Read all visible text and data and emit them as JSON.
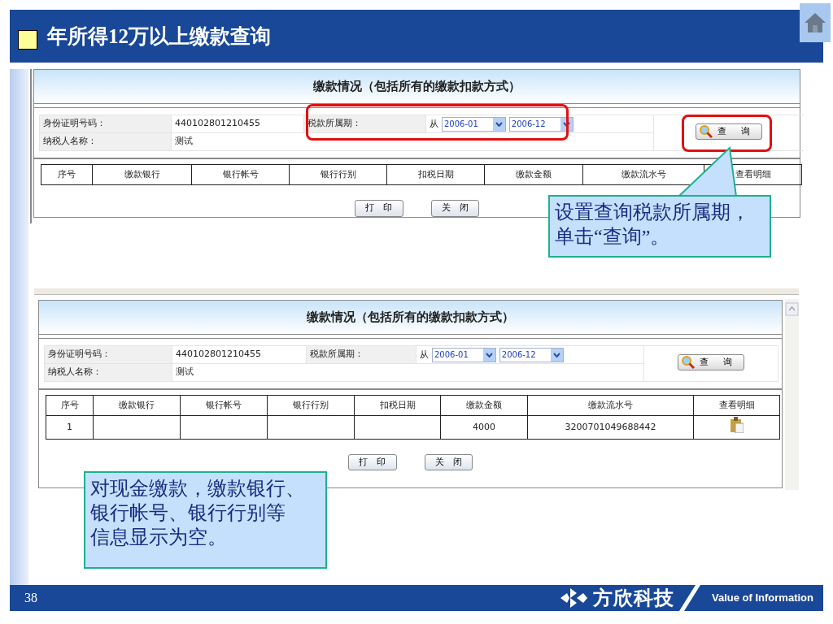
{
  "slide": {
    "title": "年所得12万以上缴款查询",
    "page_number": "38"
  },
  "footer": {
    "logo_text": "方欣科技",
    "tagline": "Value of Information"
  },
  "screenshots": [
    {
      "heading": "缴款情况（包括所有的缴款扣款方式）",
      "id_label": "身份证明号码：",
      "id_value": "440102801210455",
      "name_label": "纳税人名称：",
      "name_value": "测试",
      "period_label": "税款所属期：",
      "from_label": "从",
      "period_from": "2006-01",
      "period_to": "2006-12",
      "query_button": "查 询",
      "highlight_period": true,
      "highlight_query": true,
      "columns": [
        "序号",
        "缴款银行",
        "银行帐号",
        "银行行别",
        "扣税日期",
        "缴款金额",
        "缴款流水号",
        "查看明细"
      ],
      "buttons": [
        "打 印",
        "关 闭"
      ]
    },
    {
      "heading": "缴款情况（包括所有的缴款扣款方式）",
      "id_label": "身份证明号码：",
      "id_value": "440102801210455",
      "name_label": "纳税人名称：",
      "name_value": "测试",
      "period_label": "税款所属期：",
      "from_label": "从",
      "period_from": "2006-01",
      "period_to": "2006-12",
      "query_button": "查 询",
      "highlight_period": false,
      "highlight_query": false,
      "columns": [
        "序号",
        "缴款银行",
        "银行帐号",
        "银行行别",
        "扣税日期",
        "缴款金额",
        "缴款流水号",
        "查看明细"
      ],
      "rows": [
        {
          "number": "1",
          "amount": "4000",
          "serial": "3200701049688442",
          "detail_icon": true
        }
      ],
      "buttons": [
        "打 印",
        "关 闭"
      ]
    }
  ],
  "callouts": [
    {
      "lines": [
        "设置查询税款所属期，",
        "单击“查询”。"
      ],
      "pointer": true
    },
    {
      "lines": [
        "对现金缴款，缴款银行、",
        "银行帐号、银行行别等",
        "信息显示为空。"
      ],
      "pointer": false
    }
  ]
}
